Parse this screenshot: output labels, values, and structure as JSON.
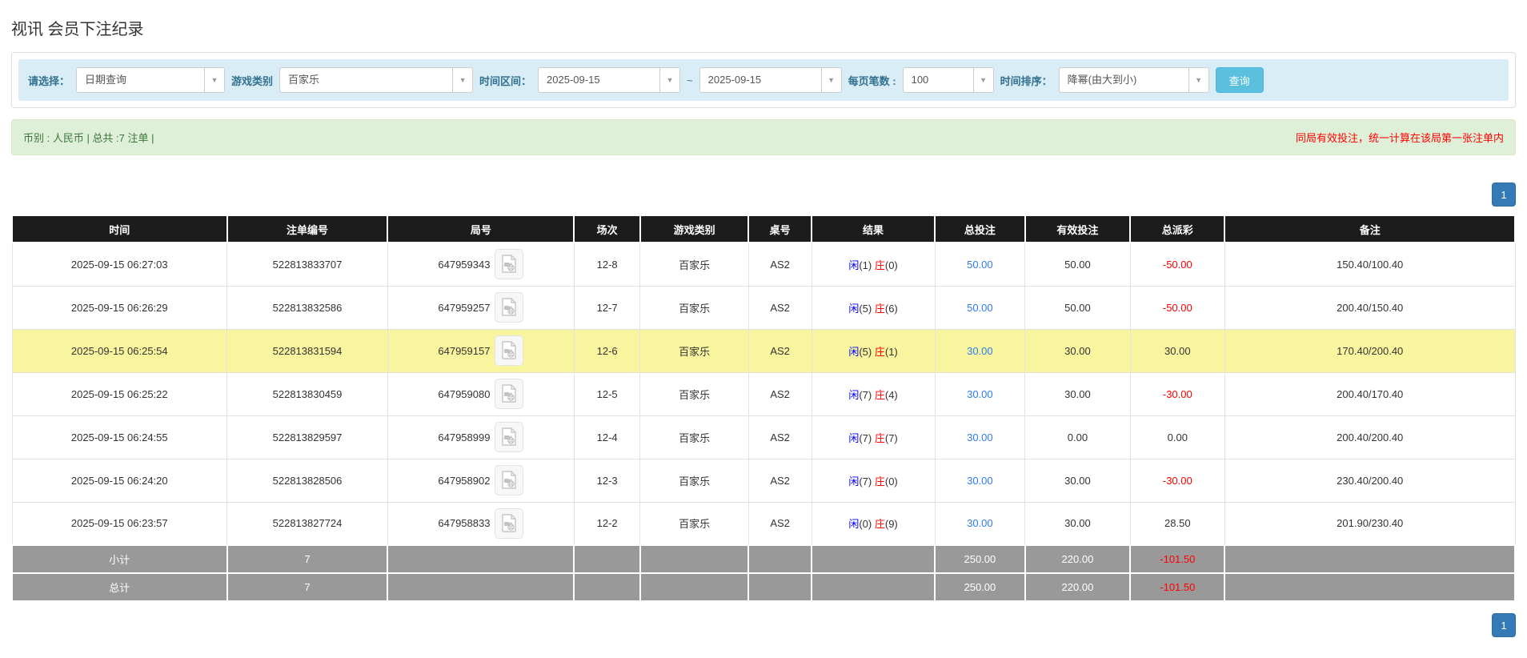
{
  "page": {
    "title": "视讯 会员下注纪录"
  },
  "filters": {
    "select_label": "请选择：",
    "select_value": "日期查询",
    "game_label": "游戏类别",
    "game_value": "百家乐",
    "range_label": "时间区间：",
    "date_from": "2025-09-15",
    "range_separator": "~",
    "date_to": "2025-09-15",
    "page_size_label": "每页笔数 :",
    "page_size_value": "100",
    "sort_label": "时间排序：",
    "sort_value": "降幂(由大到小)",
    "search_button": "查询",
    "chevron": "▼"
  },
  "summary": {
    "left": "币别 : 人民币 | 总共 :7 注单 |",
    "right_note": "同局有效投注，统一计算在该局第一张注单内"
  },
  "pagination": {
    "page": "1"
  },
  "table": {
    "columns": [
      "时间",
      "注单编号",
      "局号",
      "场次",
      "游戏类别",
      "桌号",
      "结果",
      "总投注",
      "有效投注",
      "总派彩",
      "备注"
    ],
    "rows": [
      {
        "time": "2025-09-15 06:27:03",
        "bet_no": "522813833707",
        "round_no": "647959343",
        "session": "12-8",
        "game": "百家乐",
        "table_no": "AS2",
        "result_player": "闲",
        "result_player_val": "(1)",
        "result_banker": "庄",
        "result_banker_val": "(0)",
        "total_bet": "50.00",
        "valid_bet": "50.00",
        "payout": "-50.00",
        "remark": "150.40/100.40",
        "highlighted": false
      },
      {
        "time": "2025-09-15 06:26:29",
        "bet_no": "522813832586",
        "round_no": "647959257",
        "session": "12-7",
        "game": "百家乐",
        "table_no": "AS2",
        "result_player": "闲",
        "result_player_val": "(5)",
        "result_banker": "庄",
        "result_banker_val": "(6)",
        "total_bet": "50.00",
        "valid_bet": "50.00",
        "payout": "-50.00",
        "remark": "200.40/150.40",
        "highlighted": false
      },
      {
        "time": "2025-09-15 06:25:54",
        "bet_no": "522813831594",
        "round_no": "647959157",
        "session": "12-6",
        "game": "百家乐",
        "table_no": "AS2",
        "result_player": "闲",
        "result_player_val": "(5)",
        "result_banker": "庄",
        "result_banker_val": "(1)",
        "total_bet": "30.00",
        "valid_bet": "30.00",
        "payout": "30.00",
        "remark": "170.40/200.40",
        "highlighted": true
      },
      {
        "time": "2025-09-15 06:25:22",
        "bet_no": "522813830459",
        "round_no": "647959080",
        "session": "12-5",
        "game": "百家乐",
        "table_no": "AS2",
        "result_player": "闲",
        "result_player_val": "(7)",
        "result_banker": "庄",
        "result_banker_val": "(4)",
        "total_bet": "30.00",
        "valid_bet": "30.00",
        "payout": "-30.00",
        "remark": "200.40/170.40",
        "highlighted": false
      },
      {
        "time": "2025-09-15 06:24:55",
        "bet_no": "522813829597",
        "round_no": "647958999",
        "session": "12-4",
        "game": "百家乐",
        "table_no": "AS2",
        "result_player": "闲",
        "result_player_val": "(7)",
        "result_banker": "庄",
        "result_banker_val": "(7)",
        "total_bet": "30.00",
        "valid_bet": "0.00",
        "payout": "0.00",
        "remark": "200.40/200.40",
        "highlighted": false
      },
      {
        "time": "2025-09-15 06:24:20",
        "bet_no": "522813828506",
        "round_no": "647958902",
        "session": "12-3",
        "game": "百家乐",
        "table_no": "AS2",
        "result_player": "闲",
        "result_player_val": "(7)",
        "result_banker": "庄",
        "result_banker_val": "(0)",
        "total_bet": "30.00",
        "valid_bet": "30.00",
        "payout": "-30.00",
        "remark": "230.40/200.40",
        "highlighted": false
      },
      {
        "time": "2025-09-15 06:23:57",
        "bet_no": "522813827724",
        "round_no": "647958833",
        "session": "12-2",
        "game": "百家乐",
        "table_no": "AS2",
        "result_player": "闲",
        "result_player_val": "(0)",
        "result_banker": "庄",
        "result_banker_val": "(9)",
        "total_bet": "30.00",
        "valid_bet": "30.00",
        "payout": "28.50",
        "remark": "201.90/230.40",
        "highlighted": false
      }
    ],
    "footer": [
      {
        "label": "小计",
        "count": "7",
        "total_bet": "250.00",
        "valid_bet": "220.00",
        "payout": "-101.50"
      },
      {
        "label": "总计",
        "count": "7",
        "total_bet": "250.00",
        "valid_bet": "220.00",
        "payout": "-101.50"
      }
    ]
  },
  "colors": {
    "header_bg": "#1c1c1c",
    "highlight_row": "#f8f59e",
    "total_row_bg": "#999999",
    "link_blue": "#2e7bf6",
    "negative_red": "#ff0000",
    "player_blue": "#0000ff",
    "banker_red": "#ff0000",
    "search_button_bg": "#5bc0de",
    "pagination_active_bg": "#337ab7",
    "filter_bar_bg": "#d9edf7",
    "filter_label_text": "#31708f",
    "summary_bg": "#dff0d8",
    "summary_text": "#3c763d",
    "note_red": "#ff0000"
  }
}
